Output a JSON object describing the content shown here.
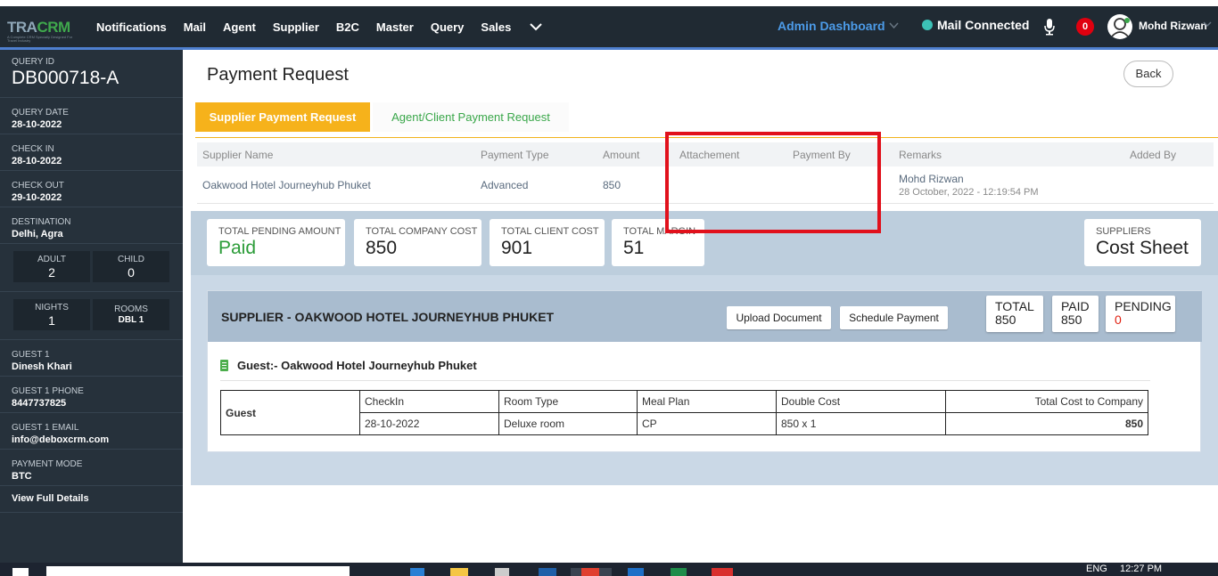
{
  "topbar": {
    "logo_text_a": "TRA",
    "logo_text_b": "CRM",
    "logo_sub": "A Complete CRM Specially Designed For Travel Industry",
    "nav": [
      "Notifications",
      "Mail",
      "Agent",
      "Supplier",
      "B2C",
      "Master",
      "Query",
      "Sales"
    ],
    "more_icon": "chevron-down-icon",
    "admin_dashboard": "Admin Dashboard",
    "mail_status": "Mail Connected",
    "notif_count": "0",
    "user_name": "Mohd Rizwan"
  },
  "sidebar": {
    "query_id_label": "QUERY ID",
    "query_id": "DB000718-A",
    "query_date_label": "QUERY DATE",
    "query_date": "28-10-2022",
    "check_in_label": "CHECK IN",
    "check_in": "28-10-2022",
    "check_out_label": "CHECK OUT",
    "check_out": "29-10-2022",
    "destination_label": "DESTINATION",
    "destination": "Delhi, Agra",
    "adult_label": "ADULT",
    "adult": "2",
    "child_label": "CHILD",
    "child": "0",
    "nights_label": "NIGHTS",
    "nights": "1",
    "rooms_label": "ROOMS",
    "rooms": "DBL 1",
    "guest1_label": "GUEST 1",
    "guest1": "Dinesh Khari",
    "phone_label": "GUEST 1 PHONE",
    "phone": "8447737825",
    "email_label": "GUEST 1 EMAIL",
    "email": "info@deboxcrm.com",
    "payment_mode_label": "PAYMENT MODE",
    "payment_mode": "BTC",
    "view_details": "View Full Details"
  },
  "main": {
    "title": "Payment Request",
    "back": "Back",
    "tabs": [
      "Supplier Payment Request",
      "Agent/Client Payment Request"
    ],
    "table_headers": {
      "supplier": "Supplier Name",
      "type": "Payment Type",
      "amount": "Amount",
      "attachment": "Attachement",
      "payment_by": "Payment By",
      "remarks": "Remarks",
      "added_by": "Added By"
    },
    "row": {
      "supplier": "Oakwood Hotel Journeyhub Phuket",
      "type": "Advanced",
      "amount": "850",
      "remarks_name": "Mohd Rizwan",
      "remarks_date": "28 October, 2022 - 12:19:54 PM"
    }
  },
  "summary": {
    "pending_label": "TOTAL PENDING AMOUNT",
    "pending": "Paid",
    "company_label": "TOTAL COMPANY COST",
    "company": "850",
    "client_label": "TOTAL CLIENT COST",
    "client": "901",
    "margin_label": "TOTAL MARGIN",
    "margin": "51",
    "suppliers_label": "SUPPLIERS",
    "suppliers": "Cost Sheet"
  },
  "supplier_panel": {
    "title": "SUPPLIER - OAKWOOD HOTEL JOURNEYHUB PHUKET",
    "upload": "Upload Document",
    "schedule": "Schedule Payment",
    "total_label": "TOTAL",
    "total": "850",
    "paid_label": "PAID",
    "paid": "850",
    "pending_label": "PENDING",
    "pending": "0",
    "guest_heading": "Guest:- Oakwood Hotel Journeyhub Phuket",
    "table": {
      "row_label": "Guest",
      "headers": [
        "CheckIn",
        "Room Type",
        "Meal Plan",
        "Double Cost",
        "Total Cost to Company"
      ],
      "values": [
        "28-10-2022",
        "Deluxe room",
        "CP",
        "850 x 1",
        "850"
      ]
    }
  },
  "taskbar": {
    "lang": "ENG",
    "time": "12:27 PM"
  },
  "colors": {
    "accent": "#f6b21b",
    "green": "#3aa74a",
    "highlight": "#e1111c",
    "sidebar": "#26313b"
  }
}
